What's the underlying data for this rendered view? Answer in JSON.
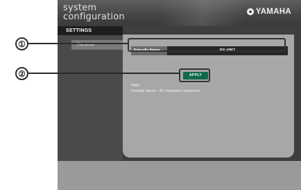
{
  "header": {
    "title_line1": "system",
    "title_line2": "configuration",
    "brand": "YAMAHA",
    "brand_icon": "yamaha-logo-icon"
  },
  "sidebar": {
    "heading": "SETTINGS",
    "items": [
      {
        "label": "Rename"
      }
    ]
  },
  "form": {
    "friendly_name_label": "Friendly Name",
    "friendly_name_value": "RX-V867",
    "apply_label": "APPLY"
  },
  "note": {
    "line1": "Note:",
    "line2": "Friendly Name : 30 characters maximum."
  },
  "callouts": {
    "one": "①",
    "two": "②"
  },
  "colors": {
    "apply_button": "#0f6a4a",
    "header": "#444444",
    "panel": "#a7a7a7"
  }
}
